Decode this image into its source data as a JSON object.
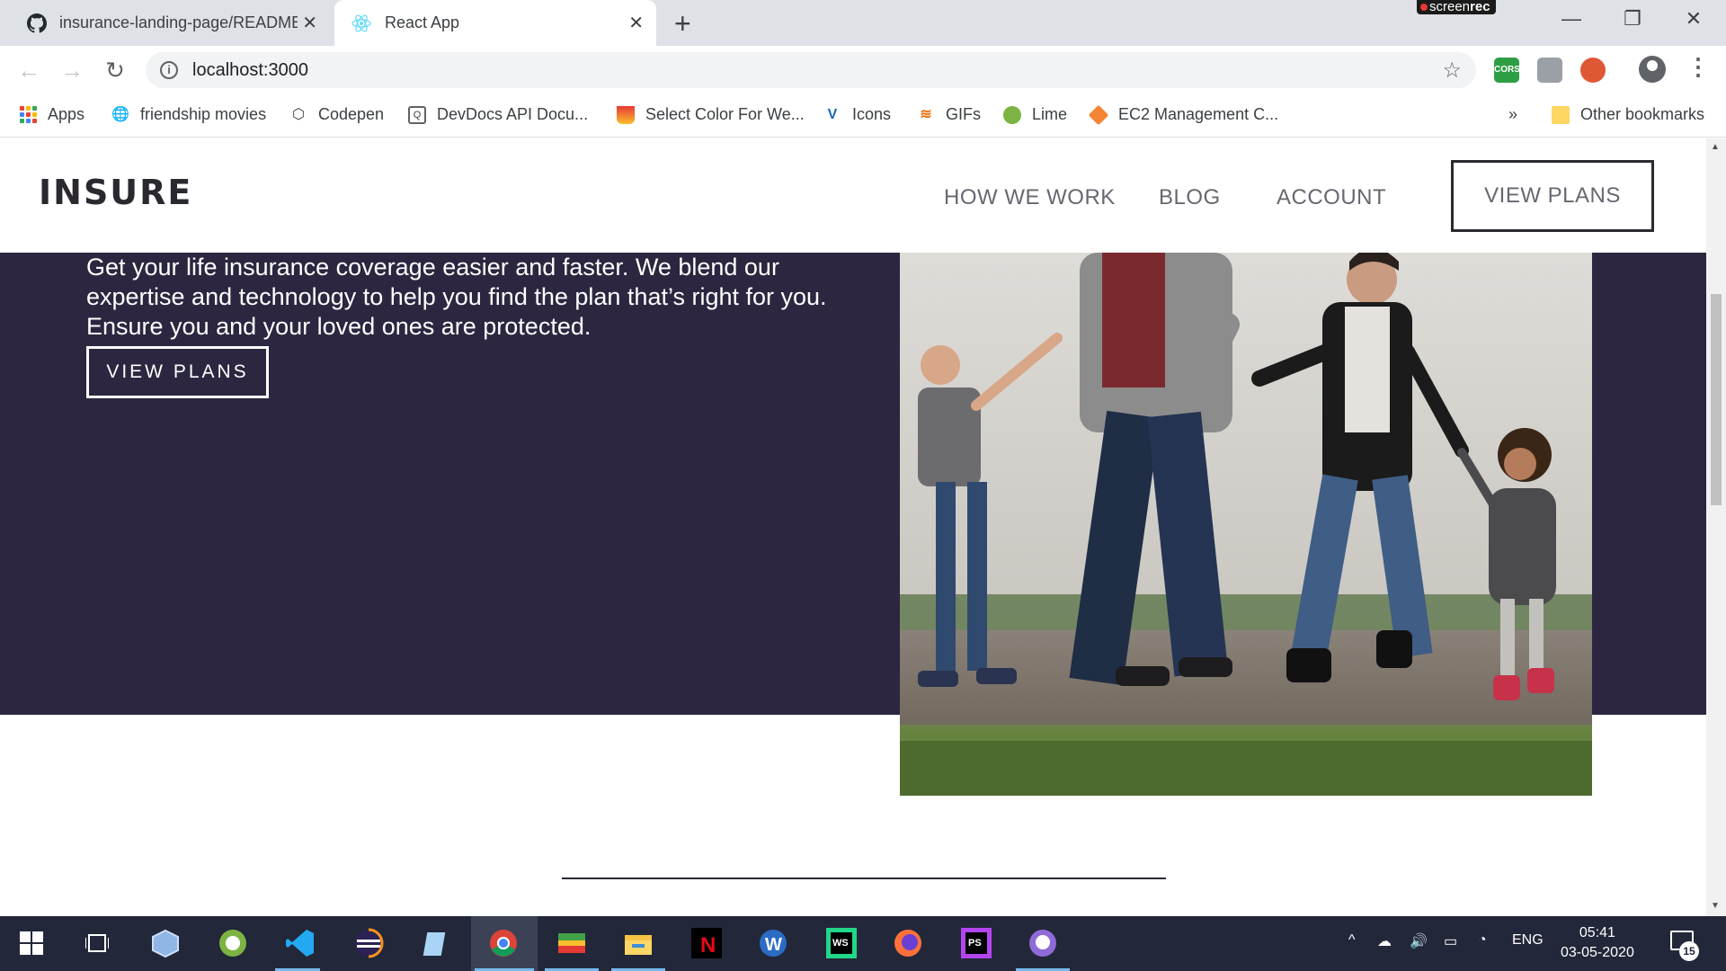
{
  "browser": {
    "tabs": [
      {
        "title": "insurance-landing-page/README.md",
        "active": false
      },
      {
        "title": "React App",
        "active": true
      }
    ],
    "new_tab_label": "+",
    "close_label": "✕",
    "recorder_badge": {
      "prefix": "screen",
      "bold": "rec"
    },
    "window": {
      "minimize": "—",
      "restore": "❐",
      "close": "✕"
    },
    "address": {
      "url": "localhost:3000",
      "info": "i"
    },
    "nav": {
      "back": "←",
      "forward": "→",
      "reload": "↻",
      "star": "☆",
      "menu": "⋮"
    },
    "extensions": [
      {
        "name": "cors-extension-icon",
        "label": "CORS",
        "color": "#2e9e45"
      },
      {
        "name": "cube-extension-icon",
        "label": "",
        "color": "#9aa0a6"
      },
      {
        "name": "duckduckgo-extension-icon",
        "label": "",
        "color": "#de5833"
      }
    ],
    "bookmarks": [
      {
        "label": "Apps",
        "icon": "apps-grid-icon"
      },
      {
        "label": "friendship movies",
        "icon": "globe-icon"
      },
      {
        "label": "Codepen",
        "icon": "codepen-icon"
      },
      {
        "label": "DevDocs API Docu...",
        "icon": "devdocs-icon"
      },
      {
        "label": "Select Color For We...",
        "icon": "color-cup-icon"
      },
      {
        "label": "Icons",
        "icon": "vuetify-icon"
      },
      {
        "label": "GIFs",
        "icon": "gifs-icon"
      },
      {
        "label": "Lime",
        "icon": "lime-icon"
      },
      {
        "label": "EC2 Management C...",
        "icon": "aws-icon"
      }
    ],
    "bookmarks_overflow": "»",
    "other_bookmarks": "Other bookmarks"
  },
  "site": {
    "logo": "INSURE",
    "nav": [
      "HOW WE WORK",
      "BLOG",
      "ACCOUNT"
    ],
    "nav_cta": "VIEW PLANS",
    "hero": {
      "text": "Get your life insurance coverage easier and faster. We blend our expertise and technology to help you find the plan that’s right for you. Ensure you and your loved ones are protected.",
      "button": "VIEW PLANS"
    },
    "colors": {
      "hero_bg": "#2c2640",
      "text_dark": "#2c2830",
      "nav_text": "#6a6670"
    }
  },
  "taskbar": {
    "apps": [
      "start-icon",
      "task-view-icon",
      "virtualbox-icon",
      "android-studio-icon",
      "vscode-icon",
      "eclipse-icon",
      "notepad-icon",
      "chrome-icon",
      "bluestacks-icon",
      "file-explorer-icon",
      "netflix-icon",
      "wps-writer-icon",
      "webstorm-icon",
      "firefox-icon",
      "phpstorm-icon",
      "github-desktop-icon"
    ],
    "tray": {
      "language": "ENG",
      "chevron": "^"
    },
    "clock": {
      "time": "05:41",
      "date": "03-05-2020"
    },
    "notifications": "15"
  }
}
